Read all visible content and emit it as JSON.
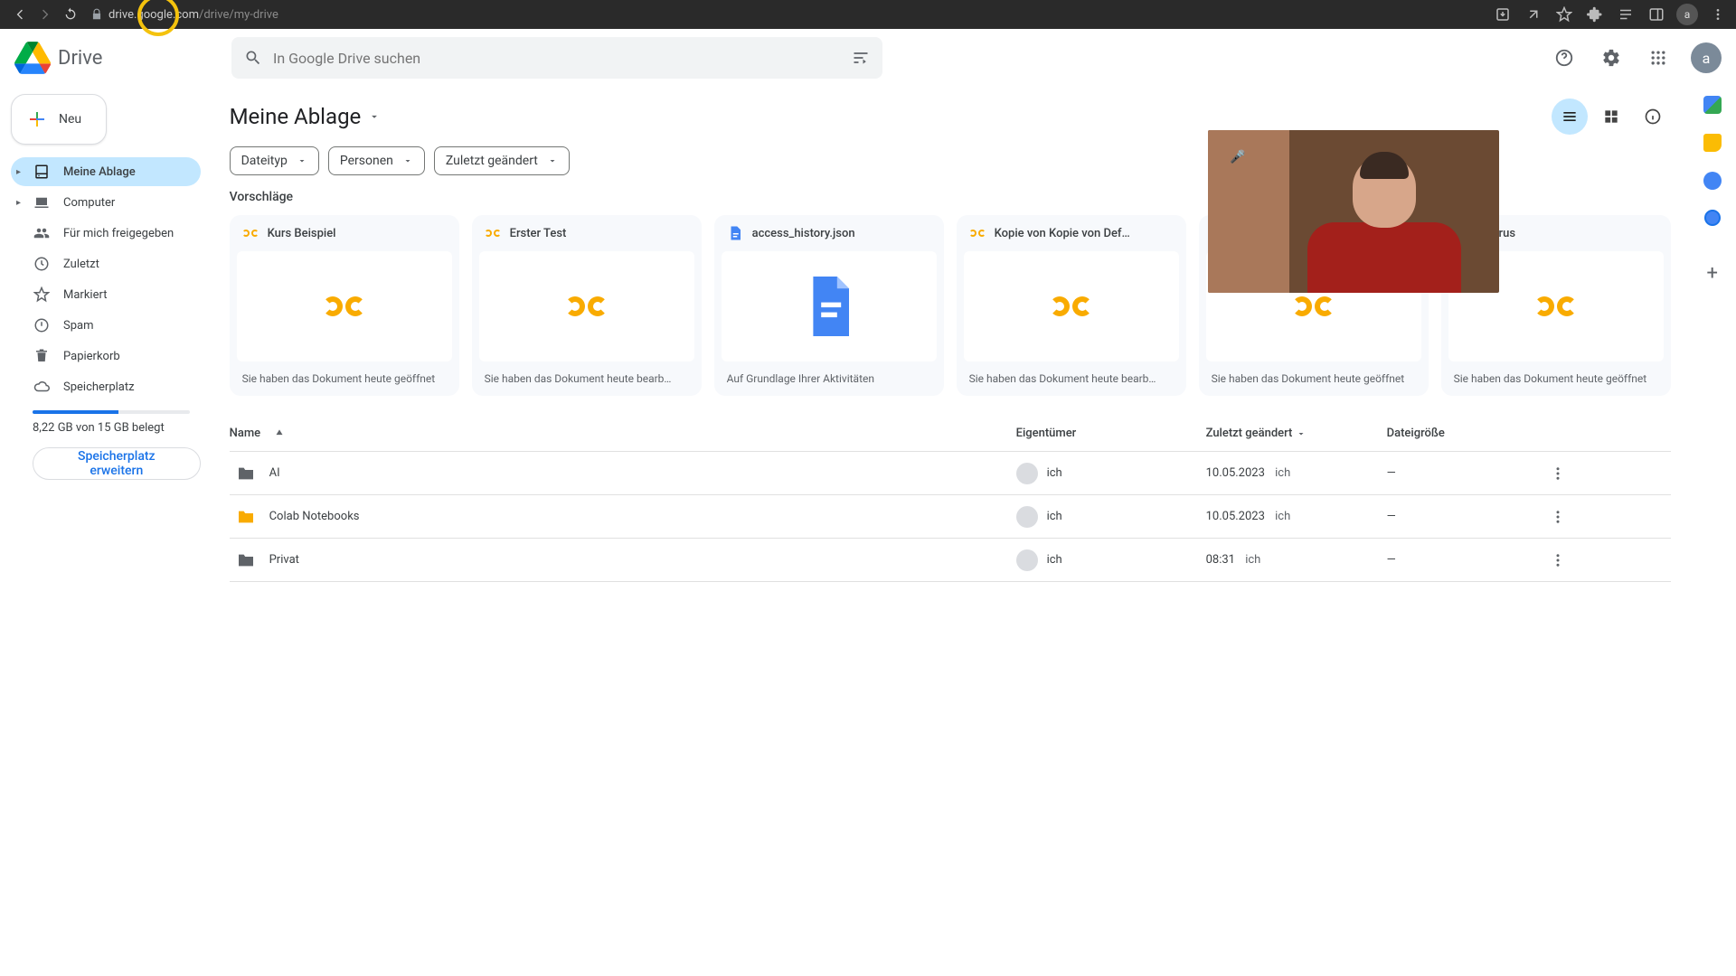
{
  "browser": {
    "url_host": "drive.google.com",
    "url_path": "/drive/my-drive",
    "avatar": "a"
  },
  "header": {
    "product": "Drive",
    "search_placeholder": "In Google Drive suchen",
    "avatar": "a"
  },
  "sidebar": {
    "new_label": "Neu",
    "items": [
      {
        "label": "Meine Ablage",
        "icon": "drive",
        "active": true,
        "expandable": true
      },
      {
        "label": "Computer",
        "icon": "laptop"
      },
      {
        "label": "Für mich freigegeben",
        "icon": "people"
      },
      {
        "label": "Zuletzt",
        "icon": "clock"
      },
      {
        "label": "Markiert",
        "icon": "star"
      },
      {
        "label": "Spam",
        "icon": "spam"
      },
      {
        "label": "Papierkorb",
        "icon": "trash"
      },
      {
        "label": "Speicherplatz",
        "icon": "cloud"
      }
    ],
    "storage_text": "8,22 GB von 15 GB belegt",
    "buy_label": "Speicherplatz erweitern"
  },
  "main": {
    "title": "Meine Ablage",
    "filters": [
      {
        "label": "Dateityp"
      },
      {
        "label": "Personen"
      },
      {
        "label": "Zuletzt geändert"
      }
    ],
    "suggestions_label": "Vorschläge",
    "suggestions": [
      {
        "title": "Kurs Beispiel",
        "type": "colab",
        "subtitle": "Sie haben das Dokument heute geöffnet"
      },
      {
        "title": "Erster Test",
        "type": "colab",
        "subtitle": "Sie haben das Dokument heute bearb…"
      },
      {
        "title": "access_history.json",
        "type": "json",
        "subtitle": "Auf Grundlage Ihrer Aktivitäten"
      },
      {
        "title": "Kopie von Kopie von Def…",
        "type": "colab",
        "subtitle": "Sie haben das Dokument heute bearb…"
      },
      {
        "title": "",
        "type": "colab",
        "subtitle": "Sie haben das Dokument heute geöffnet"
      },
      {
        "title": "Zeurus",
        "type": "colab",
        "subtitle": "Sie haben das Dokument heute geöffnet"
      }
    ],
    "columns": {
      "name": "Name",
      "owner": "Eigentümer",
      "modified": "Zuletzt geändert",
      "size": "Dateigröße"
    },
    "rows": [
      {
        "name": "AI",
        "folder": "gray",
        "owner": "ich",
        "modified_date": "10.05.2023",
        "modified_by": "ich",
        "size": "—"
      },
      {
        "name": "Colab Notebooks",
        "folder": "yellow",
        "owner": "ich",
        "modified_date": "10.05.2023",
        "modified_by": "ich",
        "size": "—"
      },
      {
        "name": "Privat",
        "folder": "gray",
        "owner": "ich",
        "modified_date": "08:31",
        "modified_by": "ich",
        "size": "—"
      }
    ]
  },
  "rail": {
    "apps": [
      "calendar",
      "keep",
      "tasks",
      "contacts"
    ]
  }
}
